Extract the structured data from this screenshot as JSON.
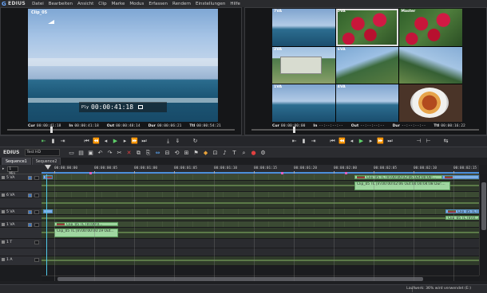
{
  "app": {
    "name": "EDIUS"
  },
  "menu": [
    "Datei",
    "Bearbeiten",
    "Ansicht",
    "Clip",
    "Marke",
    "Modus",
    "Erfassen",
    "Rendern",
    "Einstellungen",
    "Hilfe"
  ],
  "player": {
    "clip_name": "Clip_05",
    "overlay_timecode_prefix": "Ply",
    "overlay_timecode": "00:00:41:18",
    "timecodes": [
      {
        "label": "Cur",
        "value": "00:00:41:18"
      },
      {
        "label": "In",
        "value": "00:00:41:18"
      },
      {
        "label": "Out",
        "value": "00:00:48:14"
      },
      {
        "label": "Dur",
        "value": "00:00:06:21"
      },
      {
        "label": "Ttl",
        "value": "00:00:54:21"
      }
    ]
  },
  "recorder": {
    "cameras": [
      "7VA",
      "5VA",
      "Master",
      "2VA",
      "6VA",
      "",
      "1VA",
      "4VA",
      ""
    ],
    "timecodes": [
      {
        "label": "Cur",
        "value": "00:00:00:00"
      },
      {
        "label": "In",
        "value": "--:--:--:--"
      },
      {
        "label": "Out",
        "value": "--:--:--:--"
      },
      {
        "label": "Dur",
        "value": "--:--:--:--"
      },
      {
        "label": "Ttl",
        "value": "00:00:16:22"
      }
    ]
  },
  "timeline": {
    "project_name": "Test HD",
    "tabs": [
      "Sequence1",
      "Sequence2"
    ],
    "header_field": "1 Min",
    "ruler_ticks": [
      "00:00:00:00",
      "00:00:00:05",
      "00:00:01:00",
      "00:00:01:05",
      "00:00:01:10",
      "00:00:01:15",
      "00:00:01:20",
      "00:00:02:00",
      "00:00:02:05",
      "00:00:02:10",
      "00:00:02:15"
    ],
    "tracks": [
      {
        "name": "5 VA",
        "kind": "video"
      },
      {
        "name": "",
        "kind": "audio"
      },
      {
        "name": "6 VA",
        "kind": "video"
      },
      {
        "name": "",
        "kind": "audio"
      },
      {
        "name": "5 VA",
        "kind": "video"
      },
      {
        "name": "",
        "kind": "audio"
      },
      {
        "name": "1 VA",
        "kind": "video"
      },
      {
        "name": "",
        "kind": "audio"
      },
      {
        "name": "1 T",
        "kind": "title"
      },
      {
        "name": "",
        "kind": "empty"
      },
      {
        "name": "1 A",
        "kind": "audio2"
      }
    ],
    "clips": {
      "t0_right": "Clip_05  TL [In:00:00:02:06 Out:00:00:...",
      "t1_right": "Clip_05  TL [In:00:00:02:06 Out:00:00:04:08 Dur:...",
      "t6_left": "Clip_05  TL [In:00:0...",
      "t7_left": "Clip_05  TL [In:00:00:00:19 Out...",
      "t4_right": "Clip_05  TL [In:0...",
      "t5_right": "Clip_05  TL [In:0..."
    }
  },
  "status": {
    "text": "Laufwerk: 36% wird verwendet (E:)"
  }
}
